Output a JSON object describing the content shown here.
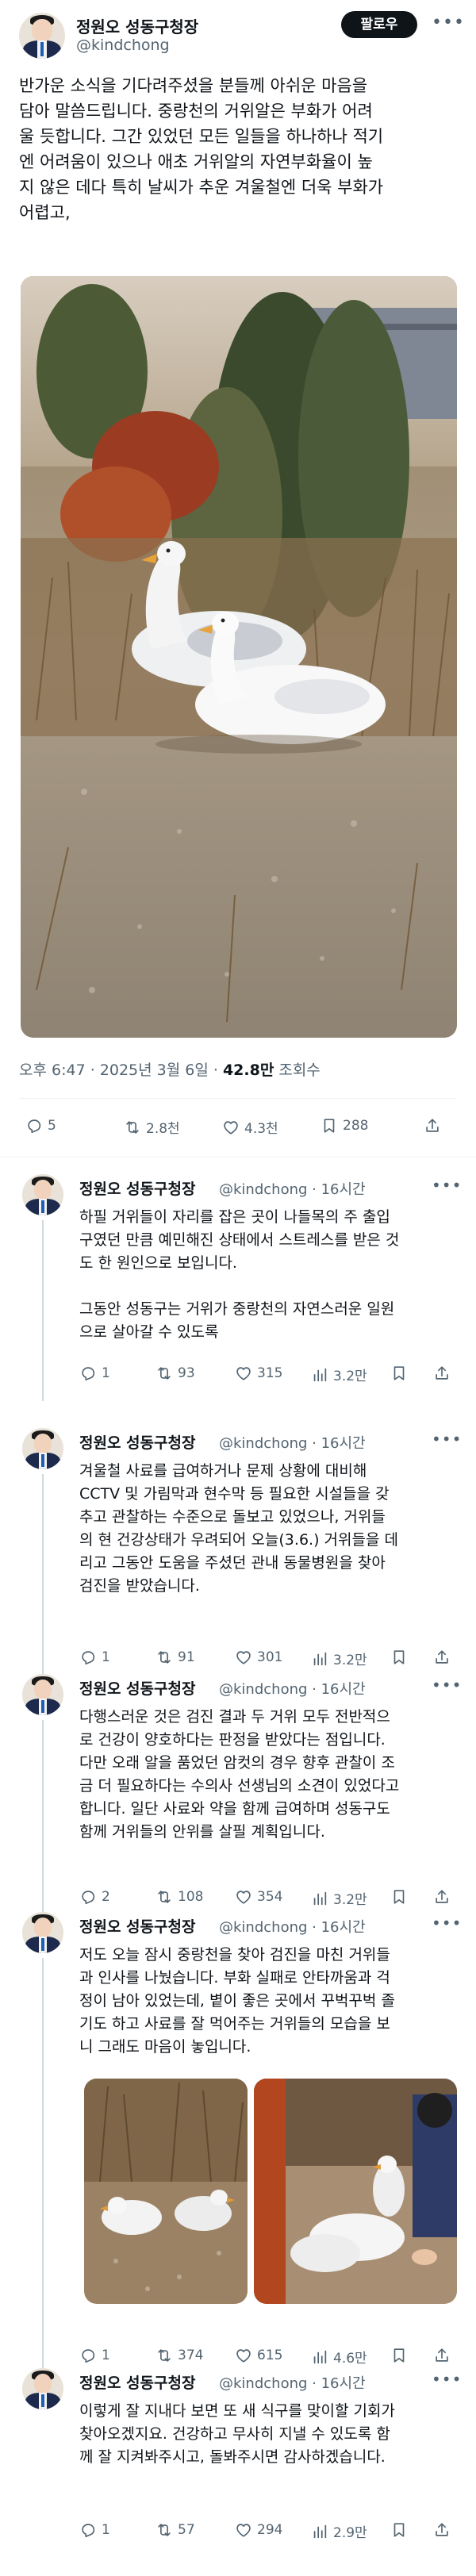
{
  "main_post": {
    "author_name": "정원오 성동구청장",
    "handle": "@kindchong",
    "follow_label": "팔로우",
    "more_label": "•••",
    "text": "반가운 소식을 기다려주셨을 분들께 아쉬운 마음을\n담아 말씀드립니다. 중랑천의 거위알은 부화가 어려\n울 듯합니다. 그간 있었던 모든 일들을 하나하나 적기\n엔 어려움이 있으나 애초 거위알의 자연부화율이 높\n지 않은 데다 특히 날씨가 추운 겨울철엔 더욱 부화가\n어렵고,",
    "meta_time": "오후 6:47 · 2025년 3월 6일 · ",
    "meta_views": "42.8만",
    "meta_views_label": " 조회수",
    "stats": {
      "replies": "5",
      "reposts": "2.8천",
      "likes": "4.3천",
      "bookmarks": "288"
    }
  },
  "replies": [
    {
      "author_name": "정원오 성동구청장",
      "handle": "@kindchong · 16시간",
      "text": "하필 거위들이 자리를 잡은 곳이 나들목의 주 출입\n구였던 만큼 예민해진 상태에서 스트레스를 받은 것\n도 한 원인으로 보입니다.\n\n그동안 성동구는 거위가 중랑천의 자연스러운 일원\n으로 살아갈 수 있도록",
      "stats": {
        "replies": "1",
        "reposts": "93",
        "likes": "315",
        "views": "3.2만"
      }
    },
    {
      "author_name": "정원오 성동구청장",
      "handle": "@kindchong · 16시간",
      "text": "겨울철 사료를 급여하거나 문제 상황에 대비해\nCCTV 및 가림막과 현수막 등 필요한 시설들을 갖\n추고 관찰하는 수준으로 돌보고 있었으나, 거위들\n의 현 건강상태가 우려되어 오늘(3.6.) 거위들을 데\n리고 그동안 도움을 주셨던 관내 동물병원을 찾아\n검진을 받았습니다.",
      "stats": {
        "replies": "1",
        "reposts": "91",
        "likes": "301",
        "views": "3.2만"
      }
    },
    {
      "author_name": "정원오 성동구청장",
      "handle": "@kindchong · 16시간",
      "text": "다행스러운 것은 검진 결과 두 거위 모두 전반적으\n로 건강이 양호하다는 판정을 받았다는 점입니다.\n다만 오래 알을 품었던 암컷의 경우 향후 관찰이 조\n금 더 필요하다는 수의사 선생님의 소견이 있었다고\n합니다. 일단 사료와 약을 함께 급여하며 성동구도\n함께 거위들의 안위를 살필 계획입니다.",
      "stats": {
        "replies": "2",
        "reposts": "108",
        "likes": "354",
        "views": "3.2만"
      }
    },
    {
      "author_name": "정원오 성동구청장",
      "handle": "@kindchong · 16시간",
      "text": "저도 오늘 잠시 중랑천을 찾아 검진을 마친 거위들\n과 인사를 나눴습니다. 부화 실패로 안타까움과 걱\n정이 남아 있었는데, 볕이 좋은 곳에서 꾸벅꾸벅 졸\n기도 하고 사료를 잘 먹어주는 거위들의 모습을 보\n니 그래도 마음이 놓입니다.",
      "stats": {
        "replies": "1",
        "reposts": "374",
        "likes": "615",
        "views": "4.6만"
      }
    },
    {
      "author_name": "정원오 성동구청장",
      "handle": "@kindchong · 16시간",
      "text": "이렇게 잘 지내다 보면 또 새 식구를 맞이할 기회가\n찾아오겠지요. 건강하고 무사히 지낼 수 있도록 함\n께 잘 지켜봐주시고, 돌봐주시면 감사하겠습니다.",
      "stats": {
        "replies": "1",
        "reposts": "57",
        "likes": "294",
        "views": "2.9만"
      }
    }
  ],
  "reply_more_label": "•••",
  "colors": {
    "text": "#0f1419",
    "muted": "#536471",
    "divider": "#eff3f4",
    "thread": "#cfd9de"
  },
  "icons": [
    "reply-icon",
    "repost-icon",
    "like-icon",
    "bookmark-icon",
    "share-icon",
    "views-icon"
  ]
}
